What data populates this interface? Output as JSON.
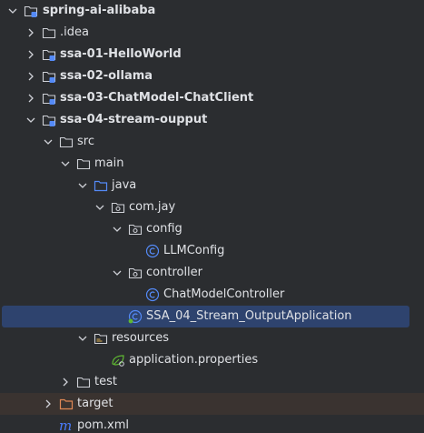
{
  "tree": {
    "root": "spring-ai-alibaba",
    "idea": ".idea",
    "module1": "ssa-01-HelloWorld",
    "module2": "ssa-02-ollama",
    "module3": "ssa-03-ChatModel-ChatClient",
    "module4": "ssa-04-stream-oupput",
    "src": "src",
    "main": "main",
    "java": "java",
    "package": "com.jay",
    "config": "config",
    "llmconfig": "LLMConfig",
    "controller": "controller",
    "chatcontroller": "ChatModelController",
    "application_class": "SSA_04_Stream_OutputApplication",
    "resources": "resources",
    "app_props": "application.properties",
    "test": "test",
    "target": "target",
    "pom": "pom.xml"
  },
  "colors": {
    "background": "#2b2d30",
    "selection": "#2e436e",
    "excluded_row": "#3a3330",
    "text": "#dfe1e5",
    "folder_stroke": "#ced0d6",
    "source_folder": "#548af7",
    "class_icon": "#548af7",
    "excluded_folder": "#e08855",
    "maven": "#4a7cff"
  },
  "icons": {
    "module": "module-folder-icon",
    "folder": "folder-icon",
    "source_root": "source-root-folder-icon",
    "package": "package-icon",
    "class": "java-class-icon",
    "spring_boot_app": "spring-boot-class-icon",
    "resources_root": "resources-root-folder-icon",
    "properties": "spring-properties-icon",
    "excluded": "excluded-folder-icon",
    "maven": "maven-icon"
  }
}
